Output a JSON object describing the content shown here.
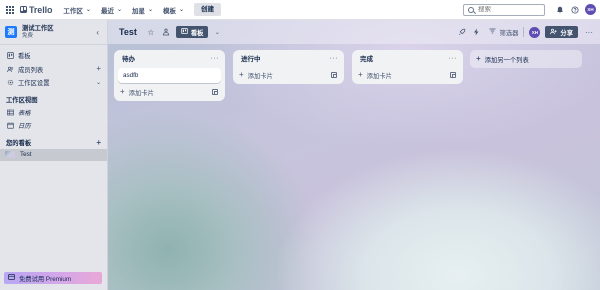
{
  "topbar": {
    "logo_text": "Trello",
    "menus": [
      {
        "label": "工作区"
      },
      {
        "label": "最近"
      },
      {
        "label": "加星"
      },
      {
        "label": "模板"
      }
    ],
    "create_label": "创建",
    "search_placeholder": "搜索",
    "avatar_initials": "XH"
  },
  "sidebar": {
    "workspace_avatar": "测",
    "workspace_name": "测试工作区",
    "workspace_plan": "免费",
    "items": [
      {
        "label": "看板",
        "icon": "board-icon"
      },
      {
        "label": "成员列表",
        "icon": "members-icon"
      },
      {
        "label": "工作区设置",
        "icon": "settings-icon"
      }
    ],
    "views_heading": "工作区视图",
    "views": [
      {
        "label": "表格",
        "icon": "table-icon"
      },
      {
        "label": "日历",
        "icon": "calendar-icon"
      }
    ],
    "boards_heading": "您的看板",
    "boards": [
      {
        "label": "Test"
      }
    ],
    "premium_label": "免费试用 Premium"
  },
  "board": {
    "title": "Test",
    "view_label": "看板",
    "filter_label": "筛选器",
    "avatar_initials": "XH",
    "share_label": "分享",
    "lists": [
      {
        "title": "待办",
        "cards": [
          "asdfb"
        ],
        "add_card_label": "添加卡片"
      },
      {
        "title": "进行中",
        "cards": [],
        "add_card_label": "添加卡片"
      },
      {
        "title": "完成",
        "cards": [],
        "add_card_label": "添加卡片"
      }
    ],
    "add_list_label": "添加另一个列表"
  },
  "colors": {
    "accent_avatar": "#5e4db2",
    "workspace_avatar": "#1d7afc",
    "dark_button": "#44546f",
    "list_bg": "#f1f2f4"
  }
}
